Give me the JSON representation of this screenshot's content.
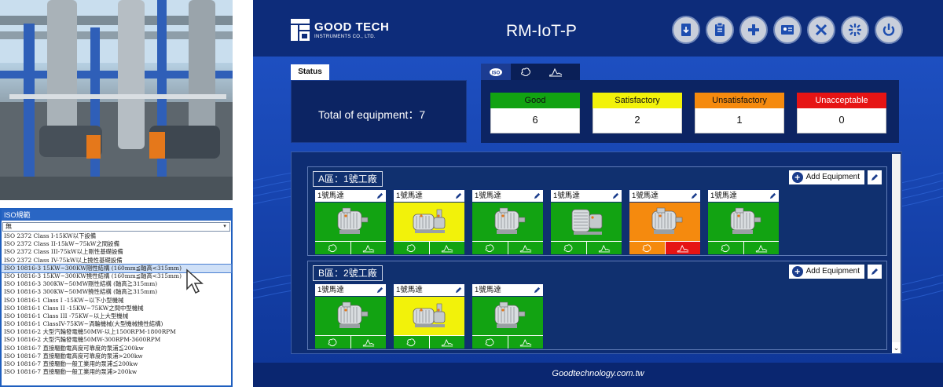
{
  "colors": {
    "app_bg": "#0d2f82",
    "good": "#12a312",
    "satisfactory": "#f2f20a",
    "unsatisfactory": "#f58a0e",
    "unacceptable": "#e61414"
  },
  "iso_dropdown": {
    "title": "ISO規範",
    "selected": "無",
    "items": [
      "ISO 2372 Class I-15KW以下設備",
      "ISO 2372 Class II-15kW~75kW之間設備",
      "ISO 2372 Class III-75kW以上剛性基礎設備",
      "ISO 2372 Class IV-75kW以上撓性基礎設備",
      "ISO 10816-3 15KW~300KW剛性結構 (160mm≦軸高<315mm)",
      "ISO 10816-3 15KW~300KW撓性結構 (160mm≦軸高<315mm)",
      "ISO 10816-3 300KW~50MW剛性結構 (軸高≧315mm)",
      "ISO 10816-3 300KW~50MW撓性結構 (軸高≧315mm)",
      "ISO 10816-1 Class I -15KW~以下小型機械",
      "ISO 10816-1 Class II -15KW~75KW之間中型機械",
      "ISO 10816-1 Class III -75KW~以上大型機械",
      "ISO 10816-1 ClassIV-75KW~渦輪機械(大型機械撓性結構)",
      "ISO 10816-2 大型汽輪發電機50MW-以上1500RPM-1800RPM",
      "ISO 10816-2 大型汽輪發電機50MW-300RPM-3600RPM",
      "ISO 10816-7 直接驅動電高度可靠度的泵浦≦200kw",
      "ISO 10816-7 直接驅動電高度可靠度的泵浦>200kw",
      "ISO 10816-7 直接驅動一般工業用的泵浦≦200kw",
      "ISO 10816-7 直接驅動一般工業用的泵浦>200kw"
    ],
    "highlighted_index": 4
  },
  "header": {
    "logo_name": "GOOD TECH",
    "logo_sub": "INSTRUMENTS CO., LTD.",
    "title": "RM-IoT-P",
    "icons": [
      "download-icon",
      "clipboard-icon",
      "plus-icon",
      "id-card-icon",
      "tools-icon",
      "settings-icon",
      "power-icon"
    ]
  },
  "status": {
    "tab_label": "Status",
    "total_label": "Total of equipment：7"
  },
  "mode_tabs": [
    "iso-icon",
    "brain-icon",
    "trend-icon"
  ],
  "grades": [
    {
      "label": "Good",
      "value": "6",
      "color": "#12a312"
    },
    {
      "label": "Satisfactory",
      "value": "2",
      "color": "#f2f20a"
    },
    {
      "label": "Unsatisfactory",
      "value": "1",
      "color": "#f58a0e"
    },
    {
      "label": "Unacceptable",
      "value": "0",
      "color": "#e61414"
    }
  ],
  "zones": [
    {
      "name": "A區：1號工廠",
      "add_label": "Add Equipment",
      "cards": [
        {
          "label": "1號馬達",
          "bg": "#12a312",
          "machine": "motor",
          "act_bg": [
            "#12a312",
            "#12a312"
          ]
        },
        {
          "label": "1號馬達",
          "bg": "#f2f20a",
          "machine": "pump",
          "act_bg": [
            "#12a312",
            "#12a312"
          ]
        },
        {
          "label": "1號馬達",
          "bg": "#12a312",
          "machine": "motor",
          "act_bg": [
            "#12a312",
            "#12a312"
          ]
        },
        {
          "label": "1號馬達",
          "bg": "#12a312",
          "machine": "fan",
          "act_bg": [
            "#12a312",
            "#12a312"
          ]
        },
        {
          "label": "1號馬達",
          "bg": "#f58a0e",
          "machine": "motor",
          "act_bg": [
            "#f58a0e",
            "#e61414"
          ]
        },
        {
          "label": "1號馬達",
          "bg": "#12a312",
          "machine": "motor",
          "act_bg": [
            "#12a312",
            "#12a312"
          ]
        }
      ]
    },
    {
      "name": "B區：2號工廠",
      "add_label": "Add Equipment",
      "cards": [
        {
          "label": "1號馬達",
          "bg": "#12a312",
          "machine": "motor",
          "act_bg": [
            "#12a312",
            "#12a312"
          ]
        },
        {
          "label": "1號馬達",
          "bg": "#f2f20a",
          "machine": "pump",
          "act_bg": [
            "#12a312",
            "#12a312"
          ]
        },
        {
          "label": "1號馬達",
          "bg": "#12a312",
          "machine": "motor",
          "act_bg": [
            "#12a312",
            "#12a312"
          ]
        }
      ]
    }
  ],
  "footer": {
    "text": "Goodtechnology.com.tw"
  }
}
